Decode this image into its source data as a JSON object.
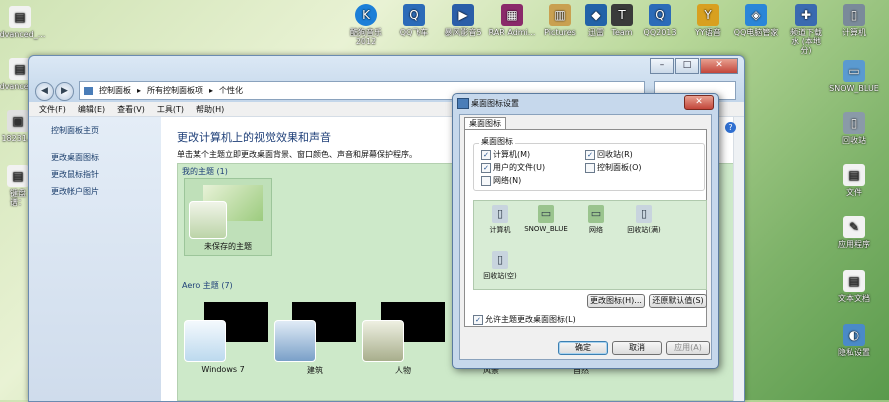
{
  "desktop": {
    "left_icons": [
      {
        "label": "advanced_...",
        "glyph": "▤"
      },
      {
        "label": "advanced_...",
        "glyph": "▤"
      },
      {
        "label": "18231...",
        "glyph": "▣"
      },
      {
        "label": "键盘\n谱：",
        "glyph": "▤"
      }
    ],
    "top_icons": [
      {
        "label": "酷狗音乐\n2012",
        "glyph": "K",
        "color": "#1c7fd8"
      },
      {
        "label": "QQ飞车",
        "glyph": "Q",
        "color": "#2b6bb8"
      },
      {
        "label": "暴风影音5",
        "glyph": "▶",
        "color": "#2a5ea8"
      },
      {
        "label": "RAR Admi...",
        "glyph": "▦",
        "color": "#8a2a6a"
      },
      {
        "label": "Pictures",
        "glyph": "▥",
        "color": "#c9a050"
      },
      {
        "label": "迅雷",
        "glyph": "◆",
        "color": "#2262a8"
      },
      {
        "label": "Team",
        "glyph": "T",
        "color": "#3a3a3a"
      },
      {
        "label": "QQ2013",
        "glyph": "Q",
        "color": "#2b6bb8"
      },
      {
        "label": "YY语音",
        "glyph": "Y",
        "color": "#d8a020"
      },
      {
        "label": "QQ电脑管家",
        "glyph": "◈",
        "color": "#2a86d8"
      },
      {
        "label": "频道下载\n水 (本地\n分)",
        "glyph": "✚",
        "color": "#3a6ab0"
      },
      {
        "label": "计算机",
        "glyph": "▯",
        "color": "#7a8a9a"
      }
    ],
    "right_icons": [
      {
        "label": "SNOW_BLUE",
        "glyph": "▭"
      },
      {
        "label": "回收站",
        "glyph": "▯"
      },
      {
        "label": "文件",
        "glyph": "▤"
      },
      {
        "label": "应用程序",
        "glyph": "✎"
      },
      {
        "label": "文本文档",
        "glyph": "▤"
      },
      {
        "label": "隐私设置",
        "glyph": "◐"
      }
    ]
  },
  "control_panel": {
    "breadcrumb": [
      "控制面板",
      "所有控制面板项",
      "个性化"
    ],
    "menu": [
      "文件(F)",
      "编辑(E)",
      "查看(V)",
      "工具(T)",
      "帮助(H)"
    ],
    "sidebar": [
      "控制面板主页",
      "更改桌面图标",
      "更改鼠标指针",
      "更改帐户图片"
    ],
    "title": "更改计算机上的视觉效果和声音",
    "subtitle": "单击某个主题立即更改桌面背景、窗口颜色、声音和屏幕保护程序。",
    "my_themes_header": "我的主题 (1)",
    "unsaved_theme": "未保存的主题",
    "aero_header": "Aero 主题 (7)",
    "aero_themes": [
      "Windows 7",
      "建筑",
      "人物",
      "风景",
      "自然"
    ]
  },
  "dialog": {
    "title": "桌面图标设置",
    "tab": "桌面图标",
    "group_label": "桌面图标",
    "checkboxes": [
      {
        "label": "计算机(M)",
        "checked": true
      },
      {
        "label": "回收站(R)",
        "checked": true
      },
      {
        "label": "用户的文件(U)",
        "checked": true
      },
      {
        "label": "控制面板(O)",
        "checked": false
      },
      {
        "label": "网络(N)",
        "checked": false
      }
    ],
    "icons": [
      "计算机",
      "SNOW_BLUE",
      "网络",
      "回收站(满)",
      "回收站(空)"
    ],
    "change_icon_button": "更改图标(H)...",
    "restore_default_button": "还原默认值(S)",
    "allow_themes_label": "允许主题更改桌面图标(L)",
    "allow_themes_checked": true,
    "ok_button": "确定",
    "cancel_button": "取消",
    "apply_button": "应用(A)"
  },
  "colors": {
    "accent": "#1e3f78",
    "theme_bg": "#cde9c9"
  }
}
